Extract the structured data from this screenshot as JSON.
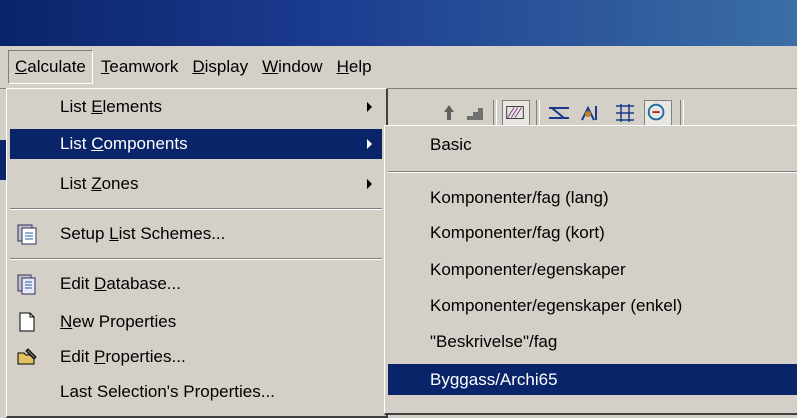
{
  "menubar": {
    "items": [
      {
        "pre": "",
        "key": "C",
        "post": "alculate"
      },
      {
        "pre": "",
        "key": "T",
        "post": "eamwork"
      },
      {
        "pre": "",
        "key": "D",
        "post": "isplay"
      },
      {
        "pre": "",
        "key": "W",
        "post": "indow"
      },
      {
        "pre": "",
        "key": "H",
        "post": "elp"
      }
    ]
  },
  "dropdown": {
    "items": [
      {
        "pre": "List ",
        "key": "E",
        "post": "lements",
        "submenu": true
      },
      {
        "pre": "List ",
        "key": "C",
        "post": "omponents",
        "submenu": true,
        "highlighted": true
      },
      {
        "pre": "List ",
        "key": "Z",
        "post": "ones",
        "submenu": true
      },
      {
        "pre": "Setup ",
        "key": "L",
        "post": "ist Schemes...",
        "icon": "list-scheme-icon"
      },
      {
        "pre": "Edit ",
        "key": "D",
        "post": "atabase...",
        "icon": "database-icon"
      },
      {
        "pre": "",
        "key": "N",
        "post": "ew Properties",
        "icon": "new-document-icon"
      },
      {
        "pre": "Edit ",
        "key": "P",
        "post": "roperties...",
        "icon": "folder-edit-icon"
      },
      {
        "pre": "Last Selection's Properties...",
        "key": "",
        "post": ""
      }
    ]
  },
  "submenu": {
    "items": [
      "Basic",
      "Komponenter/fag (lang)",
      "Komponenter/fag (kort)",
      "Komponenter/egenskaper",
      "Komponenter/egenskaper (enkel)",
      "\"Beskrivelse\"/fag",
      "Byggass/Archi65"
    ],
    "highlighted_index": 6
  },
  "colors": {
    "menu_bg": "#d4d0c8",
    "highlight": "#0a246a",
    "titlebar": "#0a246a"
  }
}
